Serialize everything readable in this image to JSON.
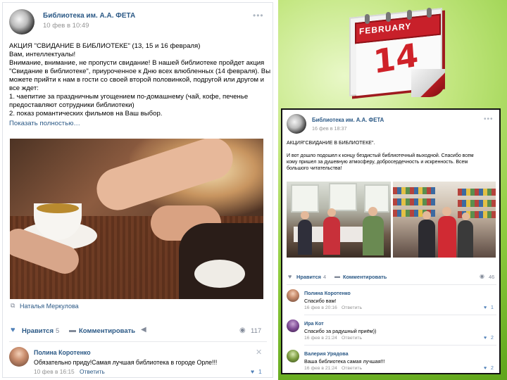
{
  "post_left": {
    "author": "Библиотека им. А.А. ФЕТА",
    "date": "10 фев в 10:49",
    "lines": [
      "АКЦИЯ \"СВИДАНИЕ В БИБЛИОТЕКЕ\" (13, 15 и 16 февраля)",
      "Вам, интеллектуалы!",
      "Внимание, внимание, не пропусти свидание! В нашей библиотеке пройдет акция",
      "\"Свидание в библиотеке\", приуроченное к Дню всех влюбленных (14 февраля). Вы",
      "можете прийти к нам в гости со своей второй половинкой, подругой или другом и",
      "все ждет:",
      "1. чаепитие за праздничным угощением по-домашнему (чай, кофе, печенье",
      "предоставляют сотрудники библиотеки)",
      "2. показ романтических фильмов на Ваш выбор."
    ],
    "show_more": "Показать полностью…",
    "photo_author": "Наталья Меркулова",
    "like_label": "Нравится",
    "like_count": "5",
    "comment_label": "Комментировать",
    "views": "117",
    "comment": {
      "name": "Полина Коротенко",
      "text": "Обязательно приду!Самая лучшая библиотека в городе Орле!!!",
      "meta": "10 фев в 16:15",
      "reply": "Ответить",
      "likes": "1"
    }
  },
  "calendar": {
    "month": "FEBRUARY",
    "day": "14"
  },
  "post_right": {
    "author": "Библиотека им. А.А. ФЕТА",
    "date": "16 фев в 18:37",
    "lines": [
      "АКЦИЯ\"СВИДАНИЕ В БИБЛИОТЕКЕ\".",
      "",
      "И вот дошло подошел к концу бездистый библиотечный выходной. Спасибо всем",
      "кому пришел за душевную атмосферу, добросердечность и искренность. Всем",
      "большого читательства!"
    ],
    "like_label": "Нравится",
    "like_count": "4",
    "comment_label": "Комментировать",
    "views": "46",
    "comments": [
      {
        "name": "Полина Коротенко",
        "text": "Спасибо вам!",
        "meta": "16 фев в 20:16",
        "reply": "Ответить",
        "likes": "1"
      },
      {
        "name": "Ира Кот",
        "text": "Спасибо за радушный приём))",
        "meta": "16 фев в 21:24",
        "reply": "Ответить",
        "likes": "2"
      },
      {
        "name": "Валерия Урядова",
        "text": "Ваша библиотека самая лучшая!!!",
        "meta": "16 фев в 21:24",
        "reply": "Ответить",
        "likes": "2"
      }
    ]
  }
}
